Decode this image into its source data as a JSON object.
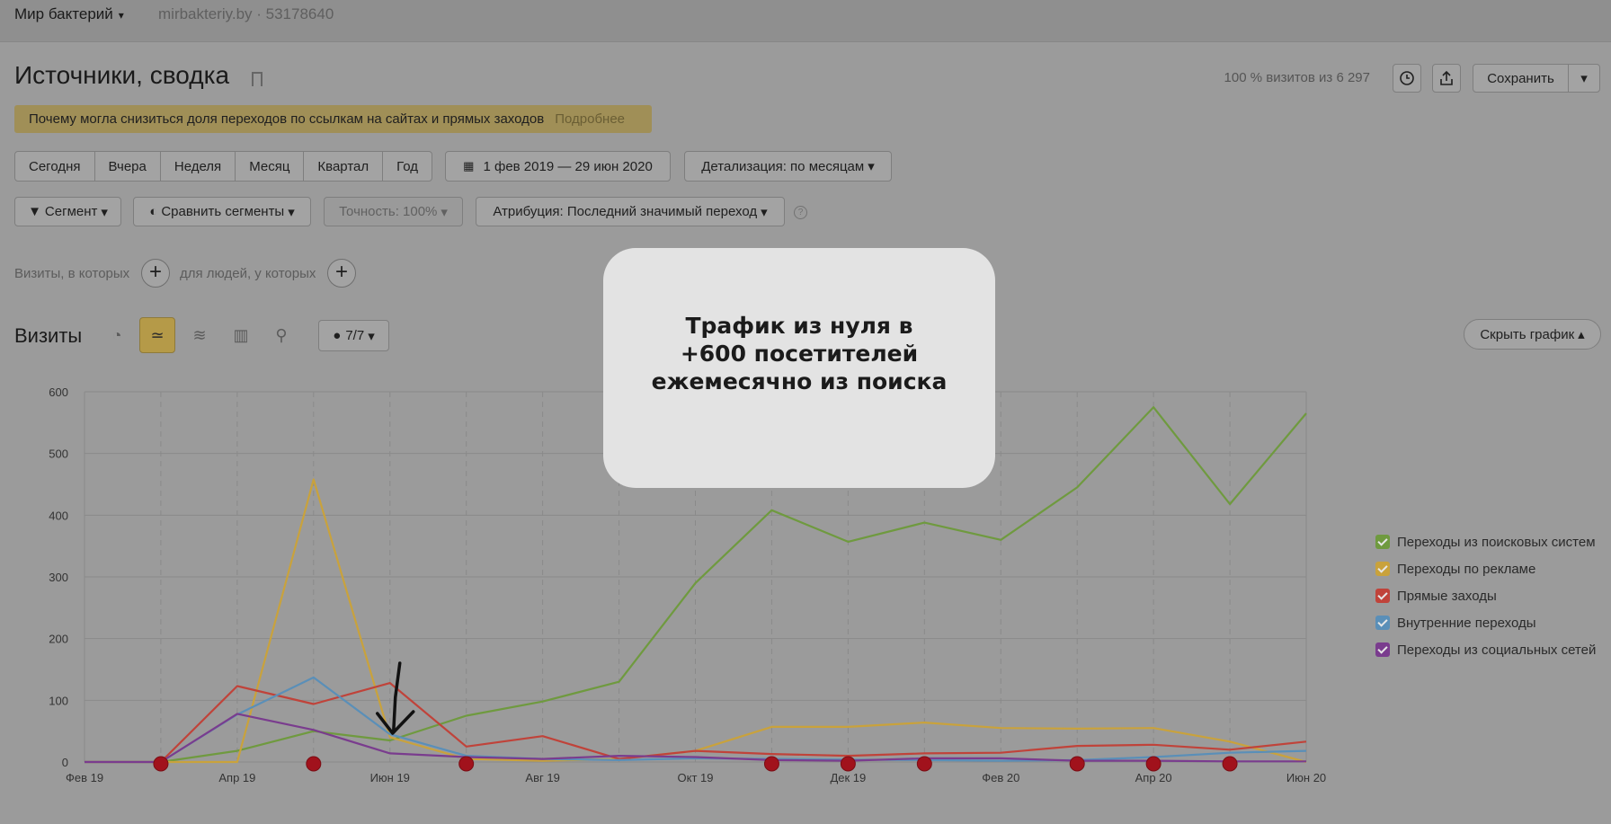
{
  "header": {
    "site_name": "Мир бактерий",
    "site_url": "mirbakteriy.by · 53178640"
  },
  "page": {
    "title": "Источники, сводка",
    "visits_stat": "100 % визитов из 6 297",
    "save_label": "Сохранить"
  },
  "notice": {
    "text": "Почему могла снизиться доля переходов по ссылкам на сайтах и прямых заходов",
    "more": "Подробнее"
  },
  "periods": [
    "Сегодня",
    "Вчера",
    "Неделя",
    "Месяц",
    "Квартал",
    "Год"
  ],
  "date_range": "1 фев 2019 — 29 июн 2020",
  "detail": "Детализация: по месяцам",
  "segment": "Сегмент",
  "compare": "Сравнить сегменты",
  "accuracy": "Точность: 100%",
  "attribution": "Атрибуция: Последний значимый переход",
  "filters": {
    "visits_label": "Визиты, в которых",
    "people_label": "для людей, у которых"
  },
  "section": {
    "title": "Визиты",
    "annotations_count": "7/7",
    "hide_chart": "Скрыть график"
  },
  "overlay": {
    "text": "Трафик из нуля в\n+600 посетителей\nежемесячно из поиска"
  },
  "colors": {
    "search": "#6f9a3f",
    "ads": "#c9a23c",
    "direct": "#c0433a",
    "internal": "#5a8fb8",
    "social": "#7a3c8e"
  },
  "chart_data": {
    "type": "line",
    "x": [
      "Фев 19",
      "Мар 19",
      "Апр 19",
      "Май 19",
      "Июн 19",
      "Июл 19",
      "Авг 19",
      "Сен 19",
      "Окт 19",
      "Ноя 19",
      "Дек 19",
      "Янв 20",
      "Фев 20",
      "Мар 20",
      "Апр 20",
      "Май 20",
      "Июн 20"
    ],
    "x_tick_labels": [
      "Фев 19",
      "Апр 19",
      "Июн 19",
      "Авг 19",
      "Окт 19",
      "Дек 19",
      "Фев 20",
      "Апр 20",
      "Июн 20"
    ],
    "ylim": [
      0,
      600
    ],
    "y_ticks": [
      0,
      100,
      200,
      300,
      400,
      500,
      600
    ],
    "grid": true,
    "legend": "right",
    "series": [
      {
        "name": "Переходы из поисковых систем",
        "color": "#6f9a3f",
        "values": [
          0,
          0,
          18,
          50,
          35,
          75,
          98,
          130,
          290,
          408,
          357,
          388,
          360,
          445,
          575,
          418,
          565
        ]
      },
      {
        "name": "Переходы по рекламе",
        "color": "#c9a23c",
        "values": [
          0,
          0,
          0,
          458,
          40,
          5,
          2,
          5,
          18,
          57,
          57,
          64,
          55,
          54,
          55,
          33,
          0
        ]
      },
      {
        "name": "Прямые заходы",
        "color": "#c0433a",
        "values": [
          0,
          0,
          123,
          94,
          128,
          25,
          42,
          5,
          18,
          13,
          10,
          14,
          15,
          26,
          28,
          20,
          33
        ]
      },
      {
        "name": "Внутренние переходы",
        "color": "#5a8fb8",
        "values": [
          0,
          0,
          77,
          137,
          45,
          10,
          5,
          3,
          6,
          5,
          4,
          3,
          2,
          3,
          8,
          15,
          18
        ]
      },
      {
        "name": "Переходы из социальных сетей",
        "color": "#7a3c8e",
        "values": [
          0,
          0,
          78,
          52,
          14,
          8,
          5,
          10,
          8,
          3,
          2,
          6,
          6,
          2,
          2,
          1,
          1
        ]
      }
    ],
    "annotation_markers_at": [
      "Мар 19",
      "Май 19",
      "Июл 19",
      "Ноя 19",
      "Дек 19",
      "Янв 20",
      "Мар 20",
      "Апр 20",
      "Май 20"
    ]
  }
}
